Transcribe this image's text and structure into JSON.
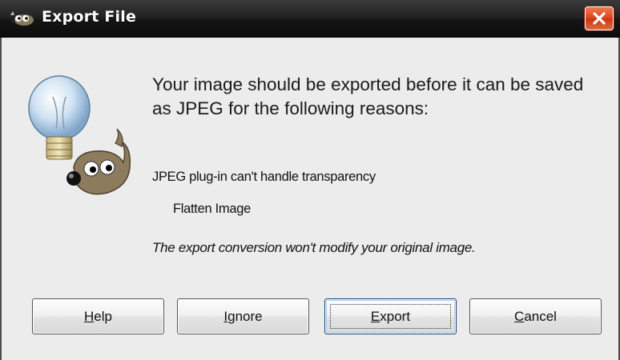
{
  "window": {
    "title": "Export File",
    "close_icon": "close-icon",
    "app_icon": "gimp-wilber-icon"
  },
  "dialog": {
    "icon": "gimp-lightbulb-icon",
    "heading": "Your image should be exported before it can be saved as JPEG for the following reasons:",
    "reason": "JPEG plug-in can't handle transparency",
    "action": "Flatten Image",
    "note": "The export conversion won't modify your original image."
  },
  "buttons": {
    "help": {
      "mnemonic": "H",
      "rest": "elp"
    },
    "ignore": {
      "mnemonic": "I",
      "rest": "gnore"
    },
    "export": {
      "mnemonic": "E",
      "rest": "xport"
    },
    "cancel": {
      "mnemonic": "C",
      "rest": "ancel"
    }
  },
  "colors": {
    "titlebar": "#1a1a1a",
    "close_button": "#d9451c",
    "dialog_bg": "#ececec",
    "default_button_border": "#1d3f6e"
  }
}
